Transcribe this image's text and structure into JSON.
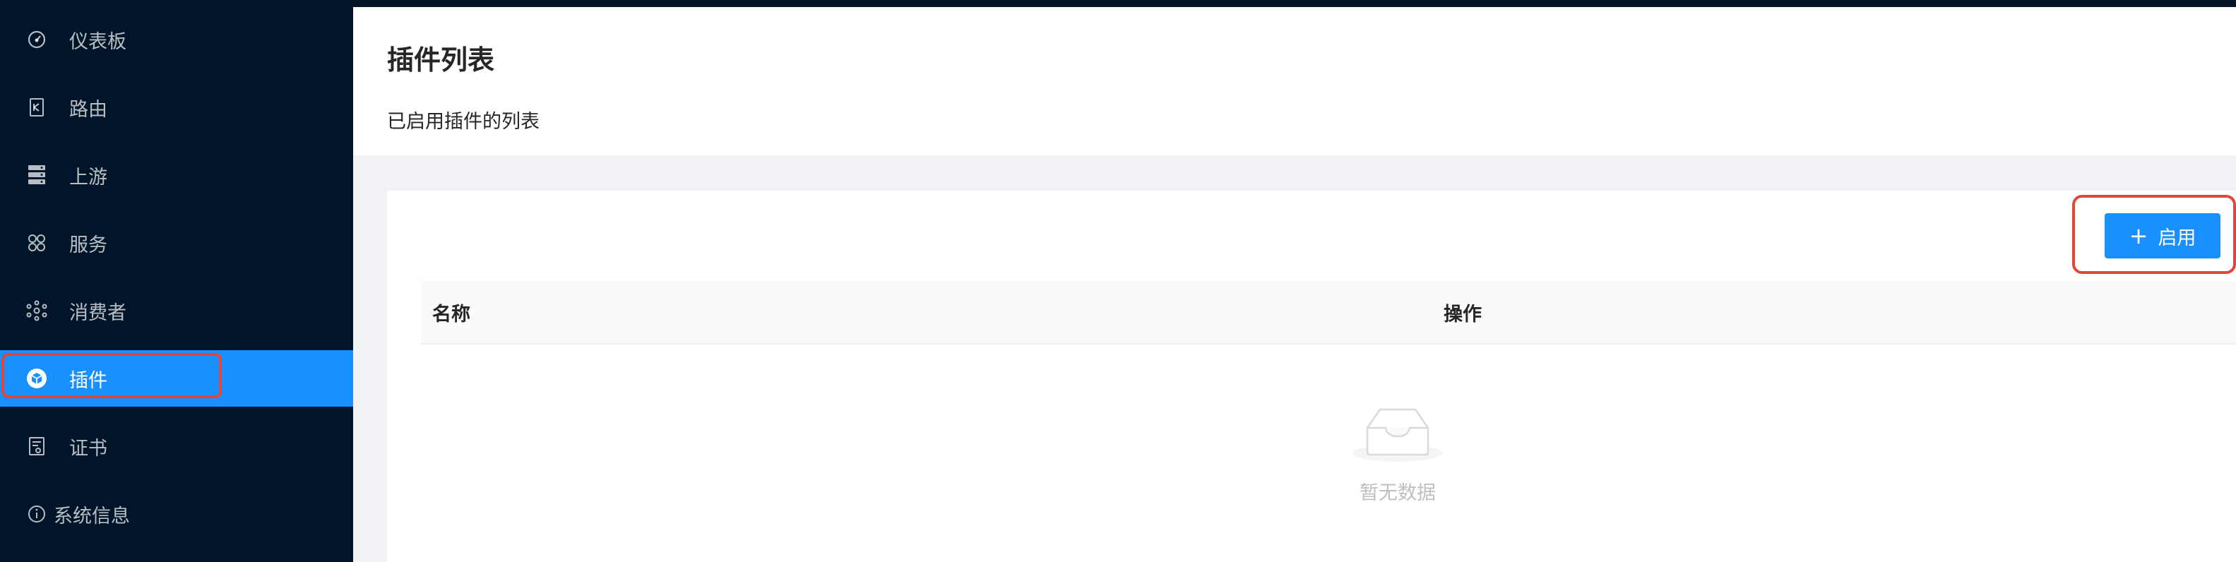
{
  "sidebar": {
    "items": [
      {
        "label": "仪表板",
        "icon": "dashboard-icon"
      },
      {
        "label": "路由",
        "icon": "route-icon"
      },
      {
        "label": "上游",
        "icon": "upstream-icon"
      },
      {
        "label": "服务",
        "icon": "service-icon"
      },
      {
        "label": "消费者",
        "icon": "consumer-icon"
      },
      {
        "label": "插件",
        "icon": "plugin-icon",
        "active": true
      },
      {
        "label": "证书",
        "icon": "certificate-icon"
      },
      {
        "label": "系统信息",
        "icon": "info-icon"
      }
    ]
  },
  "header": {
    "title": "插件列表",
    "subtitle": "已启用插件的列表"
  },
  "toolbar": {
    "enable_label": "启用",
    "enable_icon": "plus-icon"
  },
  "table": {
    "columns": [
      "名称",
      "操作"
    ],
    "rows": [],
    "empty_text": "暂无数据"
  },
  "colors": {
    "sidebar_bg": "#001529",
    "accent": "#1890ff",
    "highlight_box": "#e0463a"
  }
}
